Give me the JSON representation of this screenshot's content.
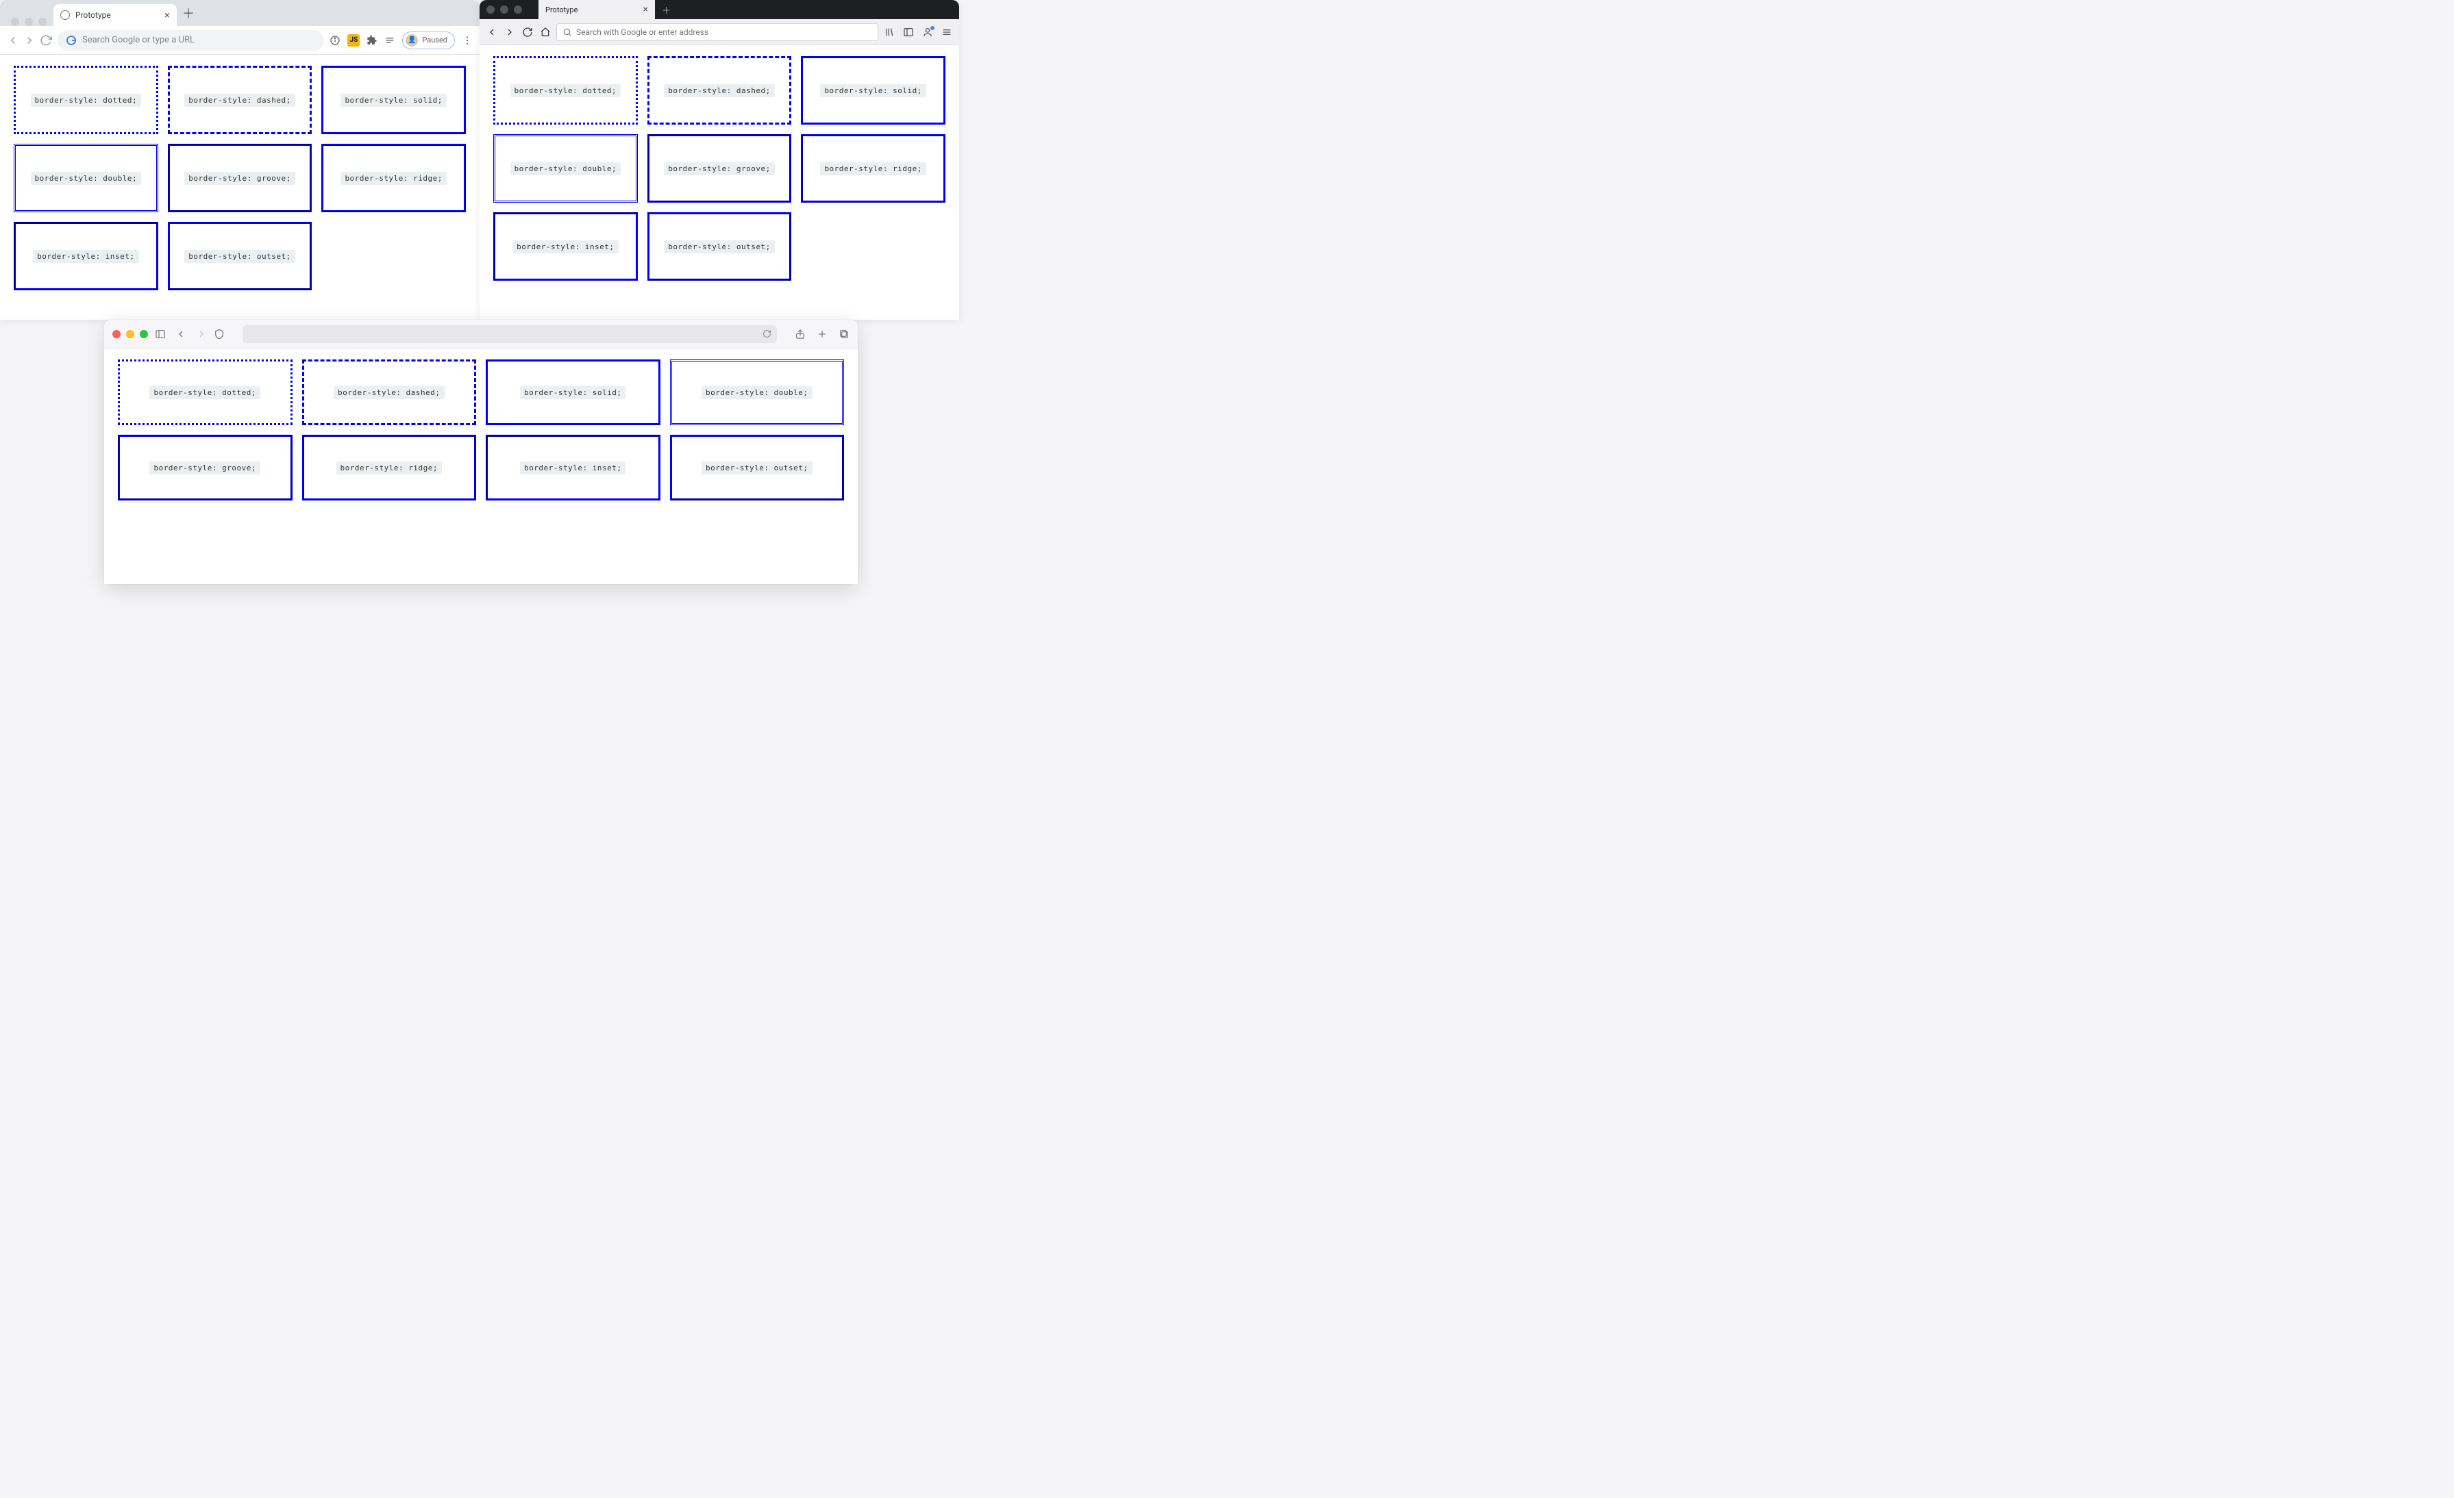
{
  "chrome": {
    "tab_title": "Prototype",
    "omnibox_placeholder": "Search Google or type a URL",
    "profile_label": "Paused",
    "content": {
      "border_color": "blue",
      "styles_row1": [
        "border-style: dotted;",
        "border-style: dashed;",
        "border-style: solid;"
      ],
      "styles_row2": [
        "border-style: double;",
        "border-style: groove;",
        "border-style: ridge;"
      ],
      "styles_row3": [
        "border-style: inset;",
        "border-style: outset;"
      ]
    }
  },
  "firefox": {
    "tab_title": "Prototype",
    "urlbar_placeholder": "Search with Google or enter address",
    "content": {
      "border_color": "blue",
      "styles_row1": [
        "border-style: dotted;",
        "border-style: dashed;",
        "border-style: solid;"
      ],
      "styles_row2": [
        "border-style: double;",
        "border-style: groove;",
        "border-style: ridge;"
      ],
      "styles_row3": [
        "border-style: inset;",
        "border-style: outset;"
      ]
    }
  },
  "safari": {
    "content": {
      "border_color": "blue",
      "styles_row1": [
        "border-style: dotted;",
        "border-style: dashed;",
        "border-style: solid;",
        "border-style: double;"
      ],
      "styles_row2": [
        "border-style: groove;",
        "border-style: ridge;",
        "border-style: inset;",
        "border-style: outset;"
      ]
    }
  }
}
